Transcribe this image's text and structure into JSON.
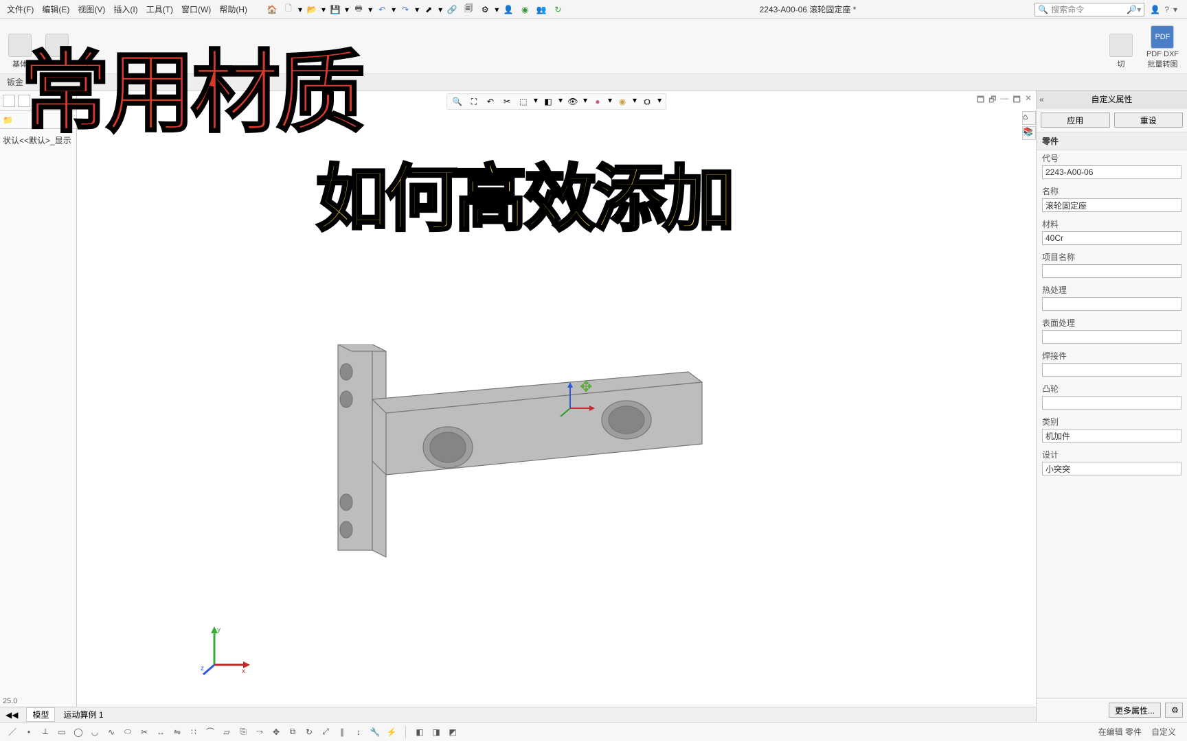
{
  "menu": {
    "file": "文件(F)",
    "edit": "编辑(E)",
    "view": "视图(V)",
    "insert": "插入(I)",
    "tools": "工具(T)",
    "window": "窗口(W)",
    "help": "帮助(H)"
  },
  "doc_title": "2243-A00-06 滚轮固定座 *",
  "search_placeholder": "搜索命令",
  "ribbon": {
    "base1": "基体",
    "base2": "基体",
    "sheetmetal": "钣金",
    "cut": "切",
    "pdfdxf": "PDF DXF",
    "batch": "批量转图"
  },
  "left": {
    "tree_text": "状认<<默认>_显示"
  },
  "overlay": {
    "red": "常用材质",
    "yellow": "如何高效添加"
  },
  "right": {
    "title": "自定义属性",
    "apply": "应用",
    "reset": "重设",
    "section_part": "零件",
    "fields": {
      "code_label": "代号",
      "code_value": "2243-A00-06",
      "name_label": "名称",
      "name_value": "滚轮固定座",
      "material_label": "材料",
      "material_value": "40Cr",
      "project_label": "项目名称",
      "project_value": "",
      "heat_label": "热处理",
      "heat_value": "",
      "surface_label": "表面处理",
      "surface_value": "",
      "weld_label": "焊接件",
      "weld_value": "",
      "cam_label": "凸轮",
      "cam_value": "",
      "category_label": "类别",
      "category_value": "机加件",
      "design_label": "设计",
      "design_value": "小突突"
    },
    "more_props": "更多属性...",
    "icon_btn": "⚙"
  },
  "bottom": {
    "model_tab": "模型",
    "motion_tab": "运动算例 1",
    "coord": "25.0"
  },
  "status_right": {
    "editing": "在编辑 零件",
    "custom": "自定义"
  }
}
